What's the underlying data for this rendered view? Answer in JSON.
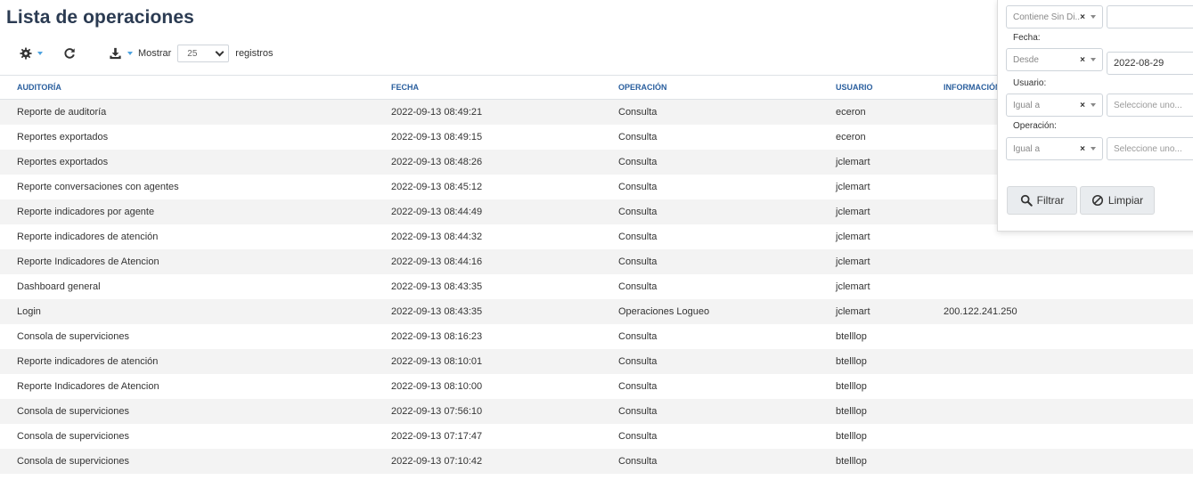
{
  "page": {
    "title": "Lista de operaciones"
  },
  "toolbar": {
    "icons": [
      "gear-icon",
      "refresh-icon",
      "download-icon"
    ],
    "show_label": "Mostrar",
    "page_size": "25",
    "records_label": "registros",
    "accent_color": "#4ea3e0"
  },
  "table": {
    "headers": [
      "AUDITORÍA",
      "FECHA",
      "OPERACIÓN",
      "USUARIO",
      "INFORMACIÓN"
    ],
    "rows": [
      [
        "Reporte de auditoría",
        "2022-09-13 08:49:21",
        "Consulta",
        "eceron",
        ""
      ],
      [
        "Reportes exportados",
        "2022-09-13 08:49:15",
        "Consulta",
        "eceron",
        ""
      ],
      [
        "Reportes exportados",
        "2022-09-13 08:48:26",
        "Consulta",
        "jclemart",
        ""
      ],
      [
        "Reporte conversaciones con agentes",
        "2022-09-13 08:45:12",
        "Consulta",
        "jclemart",
        ""
      ],
      [
        "Reporte indicadores por agente",
        "2022-09-13 08:44:49",
        "Consulta",
        "jclemart",
        ""
      ],
      [
        "Reporte indicadores de atención",
        "2022-09-13 08:44:32",
        "Consulta",
        "jclemart",
        ""
      ],
      [
        "Reporte Indicadores de Atencion",
        "2022-09-13 08:44:16",
        "Consulta",
        "jclemart",
        ""
      ],
      [
        "Dashboard general",
        "2022-09-13 08:43:35",
        "Consulta",
        "jclemart",
        ""
      ],
      [
        "Login",
        "2022-09-13 08:43:35",
        "Operaciones Logueo",
        "jclemart",
        "200.122.241.250"
      ],
      [
        "Consola de superviciones",
        "2022-09-13 08:16:23",
        "Consulta",
        "btelllop",
        ""
      ],
      [
        "Reporte indicadores de atención",
        "2022-09-13 08:10:01",
        "Consulta",
        "btelllop",
        ""
      ],
      [
        "Reporte Indicadores de Atencion",
        "2022-09-13 08:10:00",
        "Consulta",
        "btelllop",
        ""
      ],
      [
        "Consola de superviciones",
        "2022-09-13 07:56:10",
        "Consulta",
        "btelllop",
        ""
      ],
      [
        "Consola de superviciones",
        "2022-09-13 07:17:47",
        "Consulta",
        "btelllop",
        ""
      ],
      [
        "Consola de superviciones",
        "2022-09-13 07:10:42",
        "Consulta",
        "btelllop",
        ""
      ]
    ]
  },
  "filters": {
    "auditoria": {
      "operator": "Contiene Sin Di...",
      "value": ""
    },
    "fecha": {
      "label": "Fecha:",
      "operator": "Desde",
      "value": "2022-08-29"
    },
    "usuario": {
      "label": "Usuario:",
      "operator": "Igual a",
      "placeholder": "Seleccione uno..."
    },
    "operacion": {
      "label": "Operación:",
      "operator": "Igual a",
      "placeholder": "Seleccione uno..."
    },
    "filter_button": "Filtrar",
    "clear_button": "Limpiar"
  }
}
